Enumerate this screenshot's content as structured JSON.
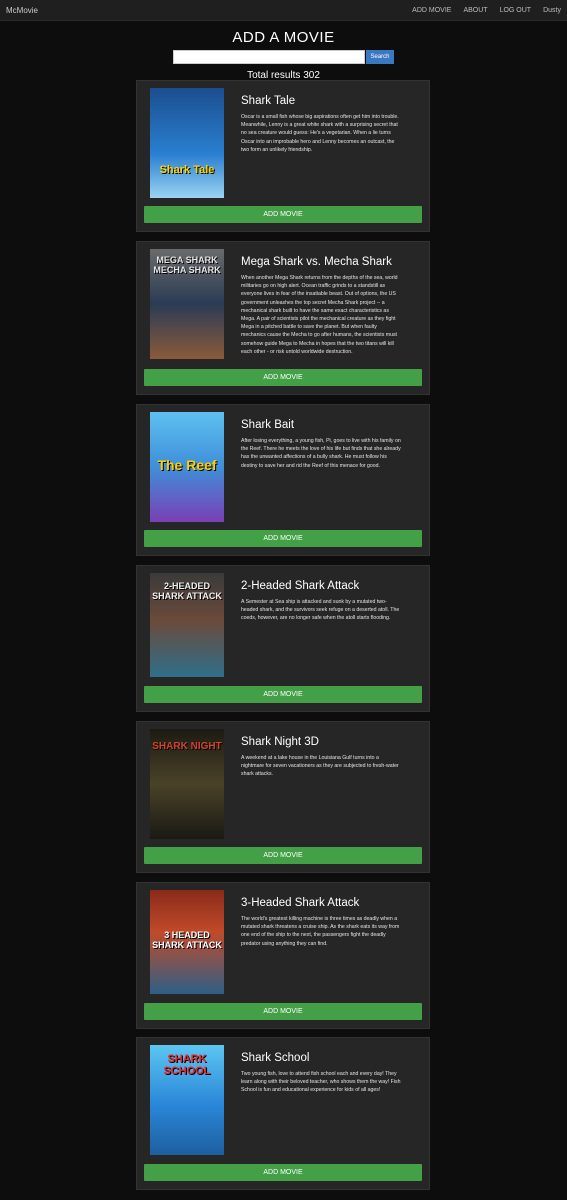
{
  "navbar": {
    "brand": "McMovie",
    "links": [
      "ADD MOVIE",
      "ABOUT",
      "LOG OUT",
      "Dusty"
    ]
  },
  "header": {
    "title": "ADD A MOVIE",
    "search_placeholder": "",
    "search_button": "Search",
    "results_label": "Total results 302"
  },
  "movies": [
    {
      "title": "Shark Tale",
      "poster_text": "Shark Tale",
      "description": "Oscar is a small fish whose big aspirations often get him into trouble. Meanwhile, Lenny is a great white shark with a surprising secret that no sea creature would guess: He's a vegetarian. When a lie turns Oscar into an improbable hero and Lenny becomes an outcast, the two form an unlikely friendship.",
      "button": "ADD MOVIE"
    },
    {
      "title": "Mega Shark vs. Mecha Shark",
      "poster_text": "MEGA SHARK MECHA SHARK",
      "description": "When another Mega Shark returns from the depths of the sea, world militaries go on high alert. Ocean traffic grinds to a standstill as everyone lives in fear of the insatiable beast. Out of options, the US government unleashes the top secret Mecha Shark project -- a mechanical shark built to have the same exact characteristics as Mega. A pair of scientists pilot the mechanical creature as they fight Mega in a pitched battle to save the planet. But when faulty mechanics cause the Mecha to go after humans, the scientists must somehow guide Mega to Mecha in hopes that the two titans will kill each other - or risk untold worldwide destruction.",
      "button": "ADD MOVIE"
    },
    {
      "title": "Shark Bait",
      "poster_text": "The Reef",
      "description": "After losing everything, a young fish, Pi, goes to live with his family on the Reef. There he meets the love of his life but finds that she already has the unwanted affections of a bully shark. He must follow his destiny to save her and rid the Reef of this menace for good.",
      "button": "ADD MOVIE"
    },
    {
      "title": "2-Headed Shark Attack",
      "poster_text": "2-HEADED SHARK ATTACK",
      "description": "A Semester at Sea ship is attacked and sunk by a mutated two-headed shark, and the survivors seek refuge on a deserted atoll. The coeds, however, are no longer safe when the atoll starts flooding.",
      "button": "ADD MOVIE"
    },
    {
      "title": "Shark Night 3D",
      "poster_text": "SHARK NIGHT",
      "description": "A weekend at a lake house in the Louisiana Gulf turns into a nightmare for seven vacationers as they are subjected to fresh-water shark attacks.",
      "button": "ADD MOVIE"
    },
    {
      "title": "3-Headed Shark Attack",
      "poster_text": "3 HEADED SHARK ATTACK",
      "description": "The world's greatest killing machine is three times as deadly when a mutated shark threatens a cruise ship. As the shark eats its way from one end of the ship to the next, the passengers fight the deadly predator using anything they can find.",
      "button": "ADD MOVIE"
    },
    {
      "title": "Shark School",
      "poster_text": "SHARK SCHOOL",
      "description": "Two young fish, love to attend fish school each and every day! They learn along with their beloved teacher, who shows them the way! Fish School is fun and educational experience for kids of all ages!",
      "button": "ADD MOVIE"
    }
  ],
  "colors": {
    "button_green": "#43a047",
    "search_blue": "#3b78c2",
    "card_bg": "#262626"
  }
}
